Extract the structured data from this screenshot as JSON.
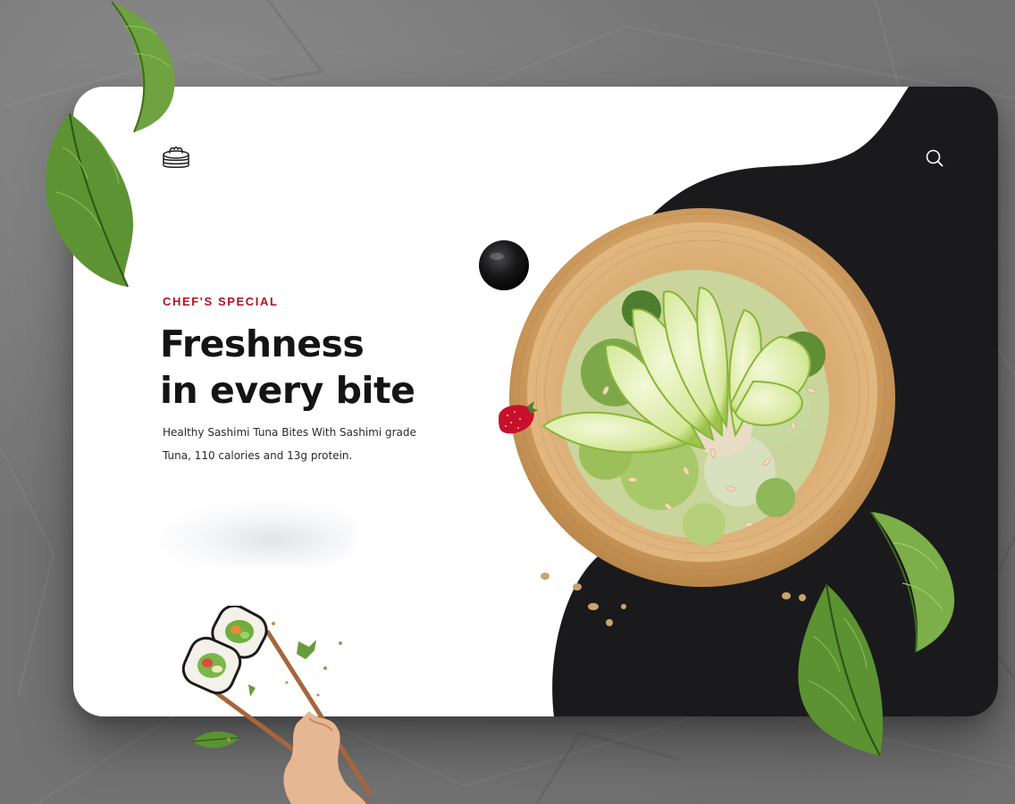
{
  "hero": {
    "eyebrow": "CHEF'S SPECIAL",
    "headline_line1": "Freshness",
    "headline_line2": "in every bite",
    "description_line1": "Healthy Sashimi Tuna Bites With Sashimi grade",
    "description_line2": "Tuna, 110 calories and 13g protein."
  },
  "icons": {
    "logo": "dumpling-steamer-logo",
    "search": "search-icon"
  },
  "colors": {
    "accent": "#b3101e",
    "panel_dark": "#1a1a1c",
    "headline": "#141414",
    "backdrop": "#737373"
  }
}
